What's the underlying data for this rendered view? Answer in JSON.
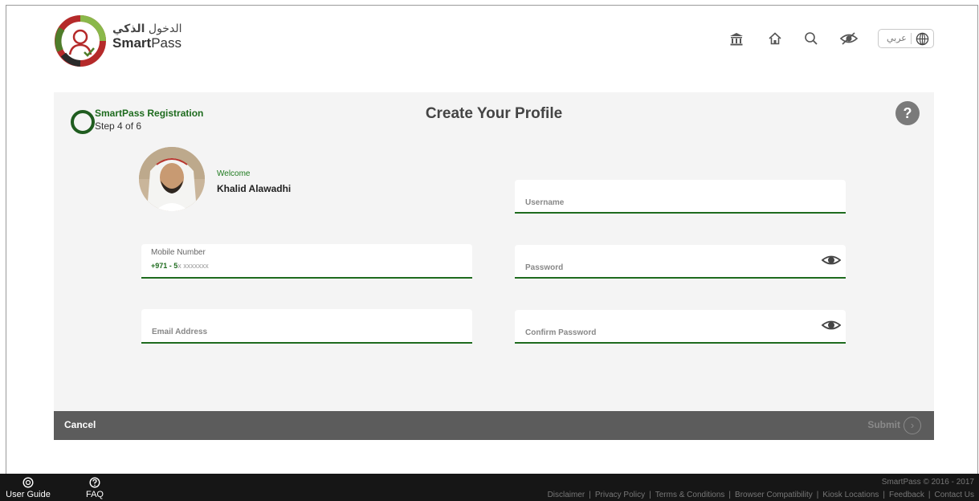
{
  "header": {
    "brand_ar_prefix": "الدخول",
    "brand_ar_bold": "الذكي",
    "brand_en_bold": "Smart",
    "brand_en_rest": "Pass",
    "lang_label": "عربي",
    "icons": [
      "institution-icon",
      "home-icon",
      "search-icon",
      "eye-slash-icon",
      "globe-icon"
    ]
  },
  "step": {
    "title": "SmartPass Registration",
    "subtitle": "Step 4 of 6"
  },
  "page": {
    "title": "Create Your Profile",
    "help_label": "?"
  },
  "user": {
    "welcome": "Welcome",
    "name": "Khalid Alawadhi"
  },
  "form": {
    "username_placeholder": "Username",
    "mobile_label": "Mobile Number",
    "mobile_prefix": "+971  -  5",
    "mobile_hint": "x xxxxxxx",
    "password_placeholder": "Password",
    "email_placeholder": "Email Address",
    "confirm_password_placeholder": "Confirm Password"
  },
  "actions": {
    "cancel": "Cancel",
    "submit": "Submit",
    "submit_icon": "›"
  },
  "footer": {
    "user_guide": "User Guide",
    "faq": "FAQ",
    "copyright": "SmartPass © 2016 - 2017",
    "links": [
      "Disclaimer",
      "Privacy Policy",
      "Terms & Conditions",
      "Browser Compatibility",
      "Kiosk Locations",
      "Feedback",
      "Contact Us"
    ]
  },
  "colors": {
    "accent_green": "#1e6b1e",
    "card_bg": "#f4f4f4",
    "action_bar": "#5c5c5c",
    "footer_bg": "#161616"
  }
}
